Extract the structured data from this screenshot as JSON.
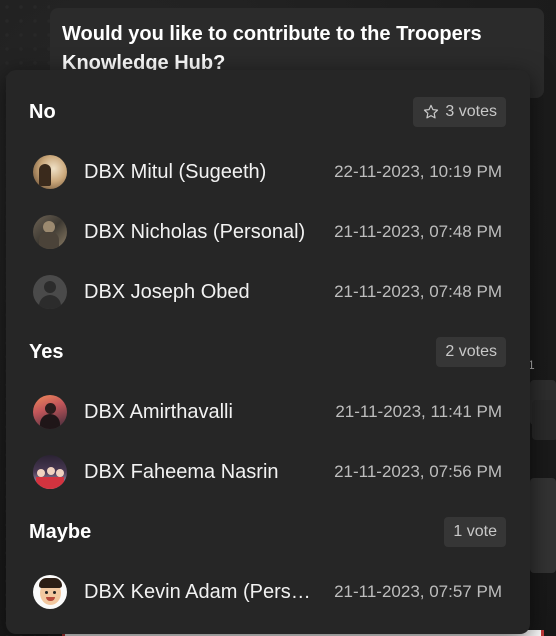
{
  "question": "Would you like to contribute to the Troopers Knowledge Hub?",
  "side_number": "1",
  "groups": [
    {
      "title": "No",
      "votes": "3 votes",
      "icon": "star-outline-icon",
      "voters": [
        {
          "name": "DBX Mitul (Sugeeth)",
          "time": "22-11-2023, 10:19 PM"
        },
        {
          "name": "DBX Nicholas (Personal)",
          "time": "21-11-2023, 07:48 PM"
        },
        {
          "name": "DBX Joseph Obed",
          "time": "21-11-2023, 07:48 PM"
        }
      ]
    },
    {
      "title": "Yes",
      "votes": "2 votes",
      "voters": [
        {
          "name": "DBX Amirthavalli",
          "time": "21-11-2023, 11:41 PM"
        },
        {
          "name": "DBX Faheema Nasrin",
          "time": "21-11-2023, 07:56 PM"
        }
      ]
    },
    {
      "title": "Maybe",
      "votes": "1 vote",
      "voters": [
        {
          "name": "DBX Kevin Adam (Perso...",
          "time": "21-11-2023, 07:57 PM"
        }
      ]
    }
  ],
  "colors": {
    "popup_bg": "#262626",
    "badge_bg": "#363636",
    "text_primary": "#ffffff",
    "text_secondary": "#bdbdbd"
  }
}
